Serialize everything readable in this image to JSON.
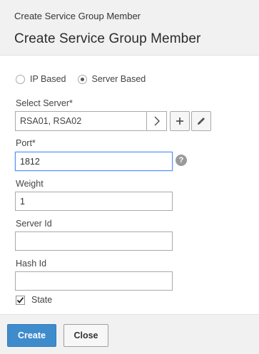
{
  "header": {
    "breadcrumb": "Create Service Group Member",
    "title": "Create Service Group Member"
  },
  "type_selector": {
    "options": [
      {
        "label": "IP Based",
        "selected": false
      },
      {
        "label": "Server Based",
        "selected": true
      }
    ]
  },
  "select_server": {
    "label": "Select Server*",
    "value": "RSA01, RSA02"
  },
  "port": {
    "label": "Port*",
    "value": "1812"
  },
  "weight": {
    "label": "Weight",
    "value": "1"
  },
  "server_id": {
    "label": "Server Id",
    "value": ""
  },
  "hash_id": {
    "label": "Hash Id",
    "value": ""
  },
  "state": {
    "label": "State",
    "checked": true
  },
  "footer": {
    "create_label": "Create",
    "close_label": "Close"
  },
  "colors": {
    "primary": "#3f8ccc",
    "focus": "#4d90fe"
  }
}
